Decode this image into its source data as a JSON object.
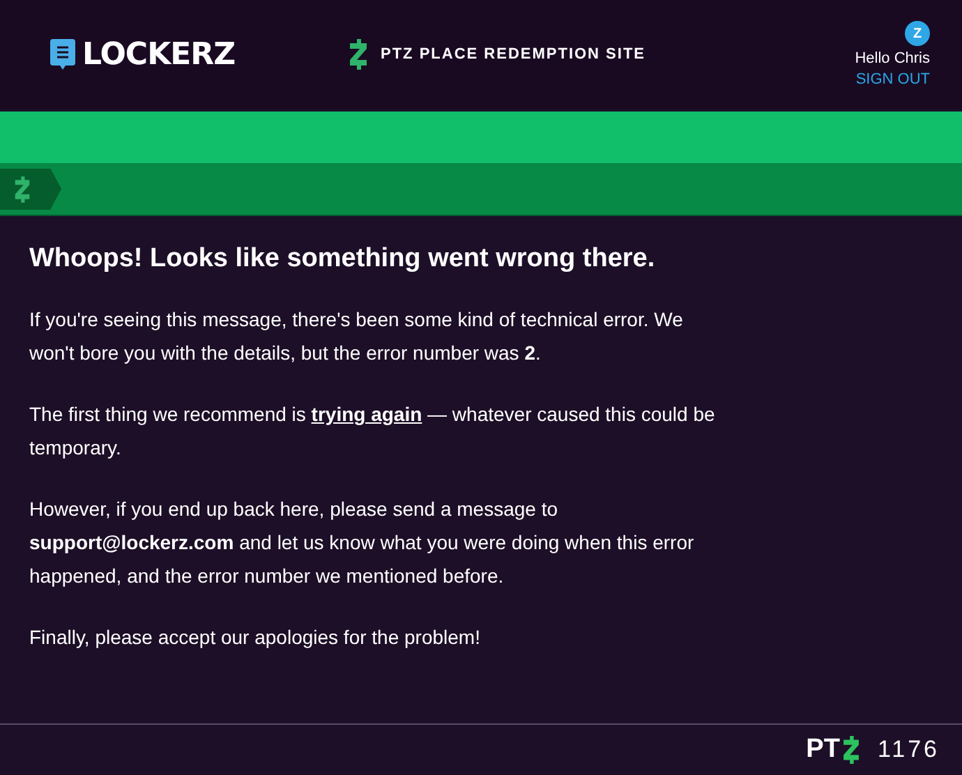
{
  "header": {
    "logo": "LOCKERZ",
    "site_title": "PTZ PLACE REDEMPTION SITE",
    "greeting": "Hello Chris",
    "sign_out": "SIGN OUT",
    "avatar_letter": "Z"
  },
  "error": {
    "title": "Whoops! Looks like something went wrong there.",
    "paragraphs": [
      "If you're seeing this message, there's been some kind of technical error. We won't bore you with the details, but the error number was **2**.",
      {
        "before": "The first thing we recommend is ",
        "link": "trying again",
        "after": " — whatever caused this could be temporary."
      },
      "However, if you end up back here, please send a message to **support@lockerz.com** and let us know what you were doing when this error happened, and the error number we mentioned before.",
      "Finally, please accept our apologies for the problem!"
    ]
  },
  "footer": {
    "brand": "PT",
    "points": "1176"
  }
}
